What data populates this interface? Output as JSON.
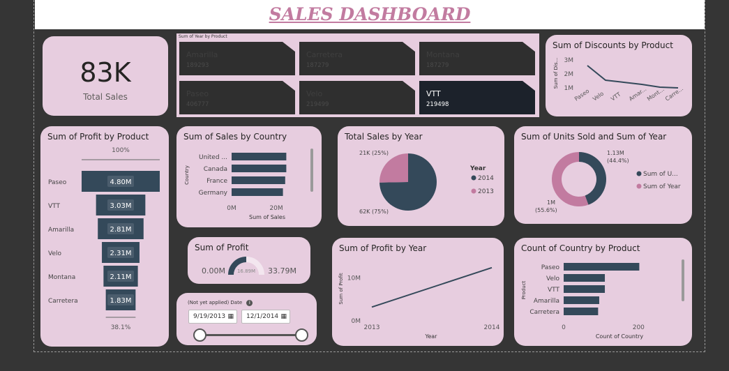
{
  "header": {
    "title": "SALES DASHBOARD"
  },
  "kpi_total_sales": {
    "value": "83K",
    "label": "Total Sales"
  },
  "tiles": {
    "title": "Sum of Year by Product",
    "items": [
      {
        "name": "Amarilla",
        "value": "189293"
      },
      {
        "name": "Carretera",
        "value": "187279"
      },
      {
        "name": "Montana",
        "value": "187279"
      },
      {
        "name": "Paseo",
        "value": "406777"
      },
      {
        "name": "Velo",
        "value": "219499"
      },
      {
        "name": "VTT",
        "value": "219498",
        "selected": true
      }
    ]
  },
  "discounts_chart": {
    "title": "Sum of Discounts by Product",
    "chart_data": {
      "type": "line",
      "title": "Sum of Discounts by Product",
      "xlabel": "",
      "ylabel": "Sum of Dis...",
      "categories": [
        "Paseo",
        "Velo",
        "VTT",
        "Amar...",
        "Mont...",
        "Carre..."
      ],
      "values": [
        2.6,
        1.55,
        1.4,
        1.25,
        1.05,
        1.0
      ],
      "yticks": [
        "3M",
        "2M",
        "1M"
      ],
      "ylim": [
        0.7,
        3.3
      ],
      "color": "#34495a"
    }
  },
  "profit_funnel": {
    "title": "Sum of Profit by Product",
    "top_label": "100%",
    "bottom_label": "38.1%",
    "chart_data": {
      "type": "funnel",
      "categories": [
        "Paseo",
        "VTT",
        "Amarilla",
        "Velo",
        "Montana",
        "Carretera"
      ],
      "values": [
        4.8,
        3.03,
        2.81,
        2.31,
        2.11,
        1.83
      ],
      "labels": [
        "4.80M",
        "3.03M",
        "2.81M",
        "2.31M",
        "2.11M",
        "1.83M"
      ],
      "unit": "M",
      "color": "#34495a"
    }
  },
  "sales_country": {
    "title": "Sum of Sales by Country",
    "chart_data": {
      "type": "bar",
      "orientation": "horizontal",
      "categories": [
        "United ...",
        "Canada",
        "France",
        "Germany"
      ],
      "values": [
        24.5,
        24.5,
        24.0,
        23.0
      ],
      "xlabel": "Sum of Sales",
      "ylabel": "Country",
      "xticks": [
        "0M",
        "20M"
      ],
      "xlim": [
        0,
        30
      ],
      "color": "#34495a"
    }
  },
  "sales_year": {
    "title": "Total Sales by Year",
    "legend_title": "Year",
    "chart_data": {
      "type": "pie",
      "categories": [
        "2014",
        "2013"
      ],
      "values": [
        62,
        21
      ],
      "labels": [
        "62K (75%)",
        "21K (25%)"
      ],
      "colors": [
        "#34495a",
        "#c27ba0"
      ],
      "legend": "right"
    }
  },
  "units_year": {
    "title": "Sum of Units Sold and Sum of Year",
    "chart_data": {
      "type": "donut",
      "categories": [
        "Sum of U...",
        "Sum of Year"
      ],
      "values": [
        44.4,
        55.6
      ],
      "labels": [
        "1.13M (44.4%)",
        "1M (55.6%)"
      ],
      "label_lines": [
        [
          "1.13M",
          "(44.4%)"
        ],
        [
          "1M",
          "(55.6%)"
        ]
      ],
      "colors": [
        "#34495a",
        "#c27ba0"
      ],
      "legend": "right"
    }
  },
  "profit_gauge": {
    "title": "Sum of Profit",
    "min": "0.00M",
    "max": "33.79M",
    "value_label": "16.89M",
    "fraction": 0.5,
    "color": "#34495a"
  },
  "date_slicer": {
    "label": "(Not yet applied) Date",
    "start": "9/19/2013",
    "end": "12/1/2014",
    "info_icon": "info-icon",
    "calendar_icon": "calendar-icon"
  },
  "profit_year": {
    "title": "Sum of Profit by Year",
    "chart_data": {
      "type": "line",
      "categories": [
        "2013",
        "2014"
      ],
      "values": [
        3.2,
        12.4
      ],
      "xlabel": "Year",
      "ylabel": "Sum of Profit",
      "yticks": [
        "10M",
        "0M"
      ],
      "ylim": [
        0,
        14
      ],
      "color": "#34495a"
    }
  },
  "country_product": {
    "title": "Count of Country by Product",
    "chart_data": {
      "type": "bar",
      "orientation": "horizontal",
      "categories": [
        "Paseo",
        "Velo",
        "VTT",
        "Amarilla",
        "Carretera"
      ],
      "values": [
        202,
        110,
        110,
        95,
        92
      ],
      "xlabel": "Count of Country",
      "ylabel": "Product",
      "xticks": [
        "0",
        "200"
      ],
      "xlim": [
        0,
        300
      ],
      "color": "#34495a"
    }
  }
}
